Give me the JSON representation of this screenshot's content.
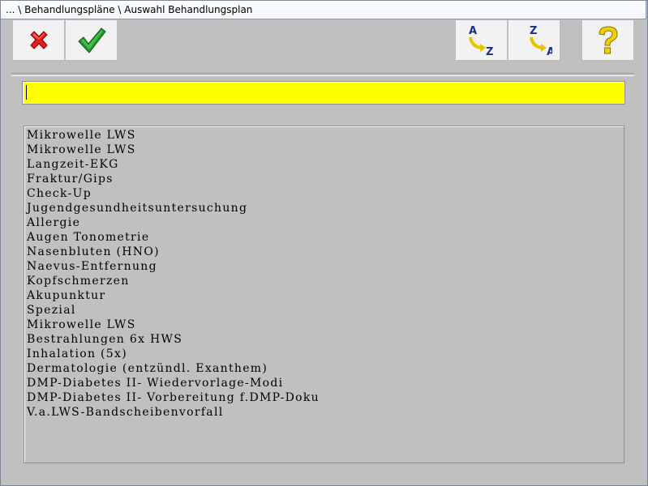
{
  "window": {
    "title": "... \\ Behandlungspläne \\ Auswahl Behandlungsplan"
  },
  "toolbar": {
    "cancel_icon": "red-x-icon",
    "confirm_icon": "green-check-icon",
    "sort_az_icon": "sort-a-z-icon",
    "sort_za_icon": "sort-z-a-icon",
    "help_icon": "yellow-question-icon",
    "sort_az_top": "A",
    "sort_az_bottom": "Z",
    "sort_za_top": "Z",
    "sort_za_bottom": "A"
  },
  "search": {
    "value": "",
    "placeholder": ""
  },
  "colors": {
    "search_bg": "#ffff00",
    "background": "#c0c0c0",
    "cancel": "#e02020",
    "confirm": "#1e9a2a",
    "help": "#f2d000"
  },
  "list": {
    "items": [
      "Mikrowelle LWS",
      "Mikrowelle LWS",
      "Langzeit-EKG",
      "Fraktur/Gips",
      "Check-Up",
      "Jugendgesundheitsuntersuchung",
      "Allergie",
      "Augen Tonometrie",
      "Nasenbluten (HNO)",
      "Naevus-Entfernung",
      "Kopfschmerzen",
      "Akupunktur",
      "Spezial",
      "Mikrowelle LWS",
      "Bestrahlungen 6x HWS",
      "Inhalation (5x)",
      "Dermatologie (entzündl. Exanthem)",
      "DMP-Diabetes II- Wiedervorlage-Modi",
      "DMP-Diabetes II- Vorbereitung f.DMP-Doku",
      "V.a.LWS-Bandscheibenvorfall"
    ]
  }
}
